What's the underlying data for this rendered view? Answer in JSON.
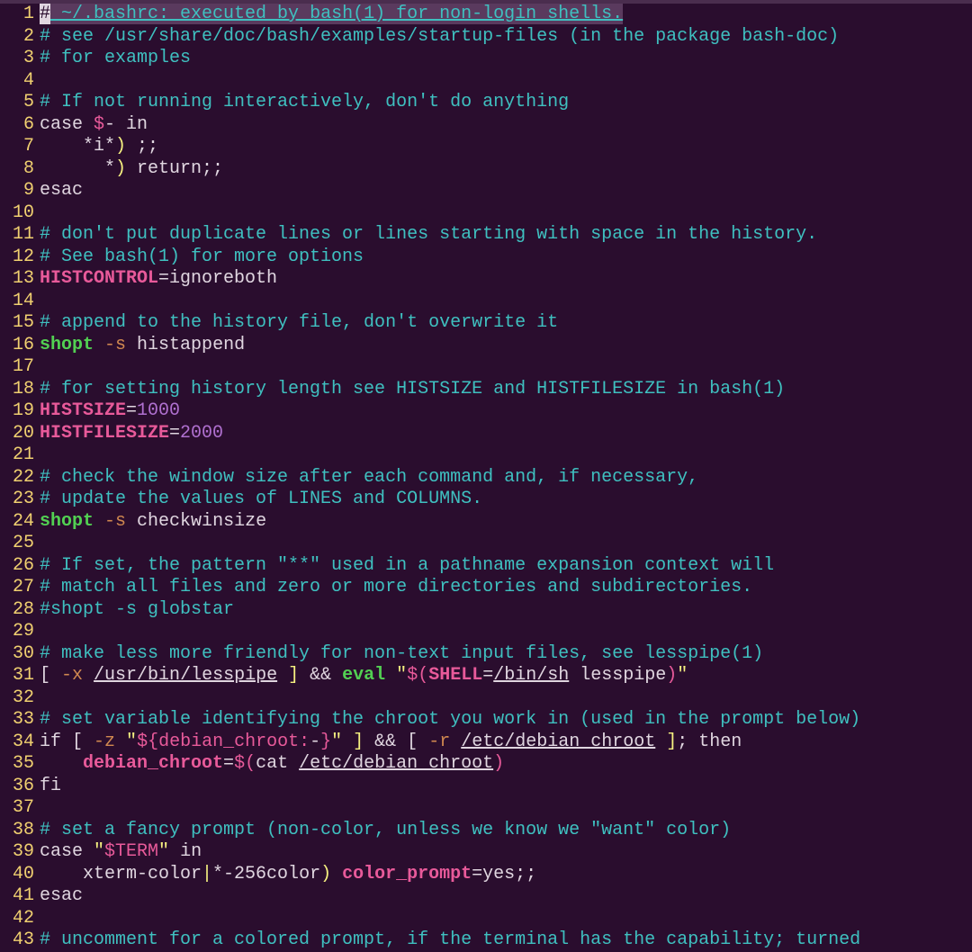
{
  "lines": [
    {
      "num": 1,
      "tokens": [
        {
          "cls": "cursor-box",
          "t": "#"
        },
        {
          "cls": "c-comment cursor-hl",
          "t": " ~/.bashrc: executed by bash(1) for non-login shells."
        }
      ]
    },
    {
      "num": 2,
      "tokens": [
        {
          "cls": "c-comment",
          "t": "# see /usr/share/doc/bash/examples/startup-files (in the package bash-doc)"
        }
      ]
    },
    {
      "num": 3,
      "tokens": [
        {
          "cls": "c-comment",
          "t": "# for examples"
        }
      ]
    },
    {
      "num": 4,
      "tokens": []
    },
    {
      "num": 5,
      "tokens": [
        {
          "cls": "c-comment",
          "t": "# If not running interactively, don't do anything"
        }
      ]
    },
    {
      "num": 6,
      "tokens": [
        {
          "cls": "c-keyword",
          "t": "case "
        },
        {
          "cls": "c-subshell",
          "t": "$"
        },
        {
          "cls": "c-default",
          "t": "- in"
        }
      ]
    },
    {
      "num": 7,
      "tokens": [
        {
          "cls": "c-default",
          "t": "    *i*"
        },
        {
          "cls": "c-paren",
          "t": ")"
        },
        {
          "cls": "c-default",
          "t": " ;;"
        }
      ]
    },
    {
      "num": 8,
      "tokens": [
        {
          "cls": "c-default",
          "t": "      *"
        },
        {
          "cls": "c-paren",
          "t": ")"
        },
        {
          "cls": "c-default",
          "t": " return;;"
        }
      ]
    },
    {
      "num": 9,
      "tokens": [
        {
          "cls": "c-keyword",
          "t": "esac"
        }
      ]
    },
    {
      "num": 10,
      "tokens": []
    },
    {
      "num": 11,
      "tokens": [
        {
          "cls": "c-comment",
          "t": "# don't put duplicate lines or lines starting with space in the history."
        }
      ]
    },
    {
      "num": 12,
      "tokens": [
        {
          "cls": "c-comment",
          "t": "# See bash(1) for more options"
        }
      ]
    },
    {
      "num": 13,
      "tokens": [
        {
          "cls": "c-var",
          "t": "HISTCONTROL"
        },
        {
          "cls": "c-op",
          "t": "=ignoreboth"
        }
      ]
    },
    {
      "num": 14,
      "tokens": []
    },
    {
      "num": 15,
      "tokens": [
        {
          "cls": "c-comment",
          "t": "# append to the history file, don't overwrite it"
        }
      ]
    },
    {
      "num": 16,
      "tokens": [
        {
          "cls": "c-builtin",
          "t": "shopt"
        },
        {
          "cls": "c-default",
          "t": " "
        },
        {
          "cls": "c-flag",
          "t": "-s"
        },
        {
          "cls": "c-default",
          "t": " histappend"
        }
      ]
    },
    {
      "num": 17,
      "tokens": []
    },
    {
      "num": 18,
      "tokens": [
        {
          "cls": "c-comment",
          "t": "# for setting history length see HISTSIZE and HISTFILESIZE in bash(1)"
        }
      ]
    },
    {
      "num": 19,
      "tokens": [
        {
          "cls": "c-var",
          "t": "HISTSIZE"
        },
        {
          "cls": "c-op",
          "t": "="
        },
        {
          "cls": "c-num",
          "t": "1000"
        }
      ]
    },
    {
      "num": 20,
      "tokens": [
        {
          "cls": "c-var",
          "t": "HISTFILESIZE"
        },
        {
          "cls": "c-op",
          "t": "="
        },
        {
          "cls": "c-num",
          "t": "2000"
        }
      ]
    },
    {
      "num": 21,
      "tokens": []
    },
    {
      "num": 22,
      "tokens": [
        {
          "cls": "c-comment",
          "t": "# check the window size after each command and, if necessary,"
        }
      ]
    },
    {
      "num": 23,
      "tokens": [
        {
          "cls": "c-comment",
          "t": "# update the values of LINES and COLUMNS."
        }
      ]
    },
    {
      "num": 24,
      "tokens": [
        {
          "cls": "c-builtin",
          "t": "shopt"
        },
        {
          "cls": "c-default",
          "t": " "
        },
        {
          "cls": "c-flag",
          "t": "-s"
        },
        {
          "cls": "c-default",
          "t": " checkwinsize"
        }
      ]
    },
    {
      "num": 25,
      "tokens": []
    },
    {
      "num": 26,
      "tokens": [
        {
          "cls": "c-comment",
          "t": "# If set, the pattern \"**\" used in a pathname expansion context will"
        }
      ]
    },
    {
      "num": 27,
      "tokens": [
        {
          "cls": "c-comment",
          "t": "# match all files and zero or more directories and subdirectories."
        }
      ]
    },
    {
      "num": 28,
      "tokens": [
        {
          "cls": "c-comment",
          "t": "#shopt -s globstar"
        }
      ]
    },
    {
      "num": 29,
      "tokens": []
    },
    {
      "num": 30,
      "tokens": [
        {
          "cls": "c-comment",
          "t": "# make less more friendly for non-text input files, see lesspipe(1)"
        }
      ]
    },
    {
      "num": 31,
      "tokens": [
        {
          "cls": "c-default",
          "t": "[ "
        },
        {
          "cls": "c-flag",
          "t": "-x"
        },
        {
          "cls": "c-default",
          "t": " "
        },
        {
          "cls": "c-path",
          "t": "/usr/bin/lesspipe"
        },
        {
          "cls": "c-default",
          "t": " "
        },
        {
          "cls": "c-paren",
          "t": "]"
        },
        {
          "cls": "c-default",
          "t": " && "
        },
        {
          "cls": "c-builtin",
          "t": "eval"
        },
        {
          "cls": "c-default",
          "t": " "
        },
        {
          "cls": "c-str",
          "t": "\""
        },
        {
          "cls": "c-subshell",
          "t": "$("
        },
        {
          "cls": "c-var",
          "t": "SHELL"
        },
        {
          "cls": "c-op",
          "t": "="
        },
        {
          "cls": "c-path",
          "t": "/bin/sh"
        },
        {
          "cls": "c-default",
          "t": " lesspipe"
        },
        {
          "cls": "c-subshell",
          "t": ")"
        },
        {
          "cls": "c-str",
          "t": "\""
        }
      ]
    },
    {
      "num": 32,
      "tokens": []
    },
    {
      "num": 33,
      "tokens": [
        {
          "cls": "c-comment",
          "t": "# set variable identifying the chroot you work in (used in the prompt below)"
        }
      ]
    },
    {
      "num": 34,
      "tokens": [
        {
          "cls": "c-keyword",
          "t": "if [ "
        },
        {
          "cls": "c-flag",
          "t": "-z"
        },
        {
          "cls": "c-default",
          "t": " "
        },
        {
          "cls": "c-str",
          "t": "\""
        },
        {
          "cls": "c-subshell",
          "t": "${debian_chroot:"
        },
        {
          "cls": "c-default",
          "t": "-"
        },
        {
          "cls": "c-subshell",
          "t": "}"
        },
        {
          "cls": "c-str",
          "t": "\""
        },
        {
          "cls": "c-default",
          "t": " "
        },
        {
          "cls": "c-paren",
          "t": "]"
        },
        {
          "cls": "c-default",
          "t": " && [ "
        },
        {
          "cls": "c-flag",
          "t": "-r"
        },
        {
          "cls": "c-default",
          "t": " "
        },
        {
          "cls": "c-path",
          "t": "/etc/debian_chroot"
        },
        {
          "cls": "c-default",
          "t": " "
        },
        {
          "cls": "c-paren",
          "t": "]"
        },
        {
          "cls": "c-default",
          "t": "; then"
        }
      ]
    },
    {
      "num": 35,
      "tokens": [
        {
          "cls": "c-default",
          "t": "    "
        },
        {
          "cls": "c-var",
          "t": "debian_chroot"
        },
        {
          "cls": "c-op",
          "t": "="
        },
        {
          "cls": "c-subshell",
          "t": "$("
        },
        {
          "cls": "c-default",
          "t": "cat "
        },
        {
          "cls": "c-path",
          "t": "/etc/debian_chroot"
        },
        {
          "cls": "c-subshell",
          "t": ")"
        }
      ]
    },
    {
      "num": 36,
      "tokens": [
        {
          "cls": "c-keyword",
          "t": "fi"
        }
      ]
    },
    {
      "num": 37,
      "tokens": []
    },
    {
      "num": 38,
      "tokens": [
        {
          "cls": "c-comment",
          "t": "# set a fancy prompt (non-color, unless we know we \"want\" color)"
        }
      ]
    },
    {
      "num": 39,
      "tokens": [
        {
          "cls": "c-keyword",
          "t": "case "
        },
        {
          "cls": "c-str",
          "t": "\""
        },
        {
          "cls": "c-subshell",
          "t": "$TERM"
        },
        {
          "cls": "c-str",
          "t": "\""
        },
        {
          "cls": "c-default",
          "t": " in"
        }
      ]
    },
    {
      "num": 40,
      "tokens": [
        {
          "cls": "c-default",
          "t": "    xterm-color"
        },
        {
          "cls": "c-paren",
          "t": "|"
        },
        {
          "cls": "c-default",
          "t": "*-256color"
        },
        {
          "cls": "c-paren",
          "t": ")"
        },
        {
          "cls": "c-default",
          "t": " "
        },
        {
          "cls": "c-var",
          "t": "color_prompt"
        },
        {
          "cls": "c-op",
          "t": "=yes;;"
        }
      ]
    },
    {
      "num": 41,
      "tokens": [
        {
          "cls": "c-keyword",
          "t": "esac"
        }
      ]
    },
    {
      "num": 42,
      "tokens": []
    },
    {
      "num": 43,
      "tokens": [
        {
          "cls": "c-comment",
          "t": "# uncomment for a colored prompt, if the terminal has the capability; turned"
        }
      ]
    }
  ]
}
